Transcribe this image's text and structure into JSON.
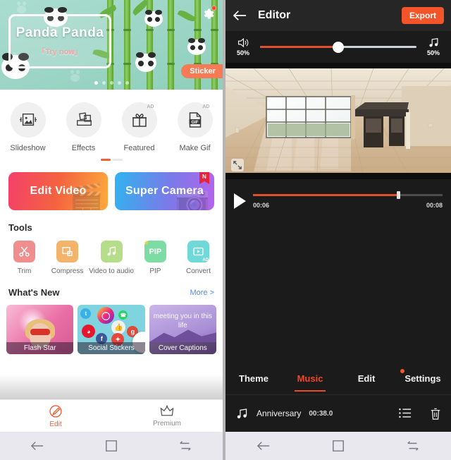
{
  "left_app": {
    "banner": {
      "title": "Panda Panda",
      "subtitle": "「Try now」",
      "sticker_label": "Sticker",
      "gear_icon": "gear-icon",
      "pagination_dots": 5,
      "pagination_active_index": 0
    },
    "quick_icons": [
      {
        "label": "Slideshow",
        "icon": "image-slideshow-icon",
        "ad": ""
      },
      {
        "label": "Effects",
        "icon": "photo-effects-icon",
        "ad": ""
      },
      {
        "label": "Featured",
        "icon": "gift-icon",
        "ad": "AD"
      },
      {
        "label": "Make Gif",
        "icon": "gif-file-icon",
        "ad": "AD"
      }
    ],
    "quick_pager": {
      "pages": 2,
      "active_index": 0
    },
    "primary_buttons": [
      {
        "label": "Edit Video",
        "icon": "video-clapper-icon",
        "badge": ""
      },
      {
        "label": "Super Camera",
        "icon": "camera-icon",
        "badge": "N"
      }
    ],
    "tools_section": {
      "heading": "Tools",
      "items": [
        {
          "label": "Trim",
          "icon": "scissors-icon",
          "color": "#f08d8d",
          "ad": "",
          "star": ""
        },
        {
          "label": "Compress",
          "icon": "compress-frame-icon",
          "color": "#f4b36a",
          "ad": "",
          "star": ""
        },
        {
          "label": "Video to audio",
          "icon": "music-notes-icon",
          "color": "#b6dd8a",
          "ad": "",
          "star": ""
        },
        {
          "label": "PIP",
          "icon": "pip-icon",
          "color": "#7ddba4",
          "ad": "",
          "star": "★"
        },
        {
          "label": "Convert",
          "icon": "convert-video-icon",
          "color": "#6fd9d9",
          "ad": "AD",
          "star": ""
        }
      ]
    },
    "whats_new": {
      "heading": "What's New",
      "more_label": "More >",
      "cards": [
        {
          "caption": "Flash Star",
          "overlay_text": ""
        },
        {
          "caption": "Social Stickers",
          "overlay_text": ""
        },
        {
          "caption": "Cover Captions",
          "overlay_text": "meeting you in this life"
        }
      ]
    },
    "tabbar": [
      {
        "label": "Edit",
        "icon": "edit-pencil-circle-icon",
        "active": true
      },
      {
        "label": "Premium",
        "icon": "crown-icon",
        "active": false
      }
    ]
  },
  "editor": {
    "header": {
      "back_icon": "back-arrow-icon",
      "title": "Editor",
      "export_label": "Export"
    },
    "volume_mix": {
      "video_icon": "speaker-icon",
      "video_value": "50%",
      "music_icon": "music-notes-icon",
      "music_value": "50%",
      "slider_percent": 50
    },
    "preview": {
      "expand_icon": "expand-fullscreen-icon"
    },
    "playback": {
      "play_icon": "play-icon",
      "current_time": "00:06",
      "total_time": "00:08",
      "progress_percent": 76
    },
    "tabs": [
      {
        "label": "Theme",
        "active": false,
        "badge": false
      },
      {
        "label": "Music",
        "active": true,
        "badge": false
      },
      {
        "label": "Edit",
        "active": false,
        "badge": false
      },
      {
        "label": "Settings",
        "active": false,
        "badge": true
      }
    ],
    "music_track": {
      "icon": "music-notes-icon",
      "name": "Anniversary",
      "duration": "00:38.0",
      "list_icon": "list-icon",
      "delete_icon": "trash-icon"
    }
  },
  "system_nav": {
    "back_icon": "nav-back-icon",
    "home_icon": "nav-home-icon",
    "recents_icon": "nav-recents-icon"
  }
}
